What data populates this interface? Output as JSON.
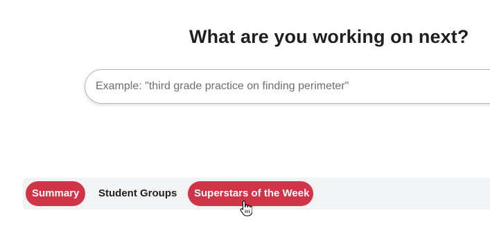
{
  "main": {
    "heading": "What are you working on next?",
    "search": {
      "value": "",
      "placeholder": "Example: \"third grade practice on finding perimeter\""
    }
  },
  "tabs": [
    {
      "label": "Summary",
      "active": true
    },
    {
      "label": "Student Groups",
      "active": false
    },
    {
      "label": "Superstars of the Week",
      "active": true
    }
  ],
  "colors": {
    "accent": "#d13447",
    "tabbar_background": "#f2f3f5",
    "text": "#1f1f1f"
  },
  "icons": {
    "cursor": "hand-pointer-icon"
  }
}
